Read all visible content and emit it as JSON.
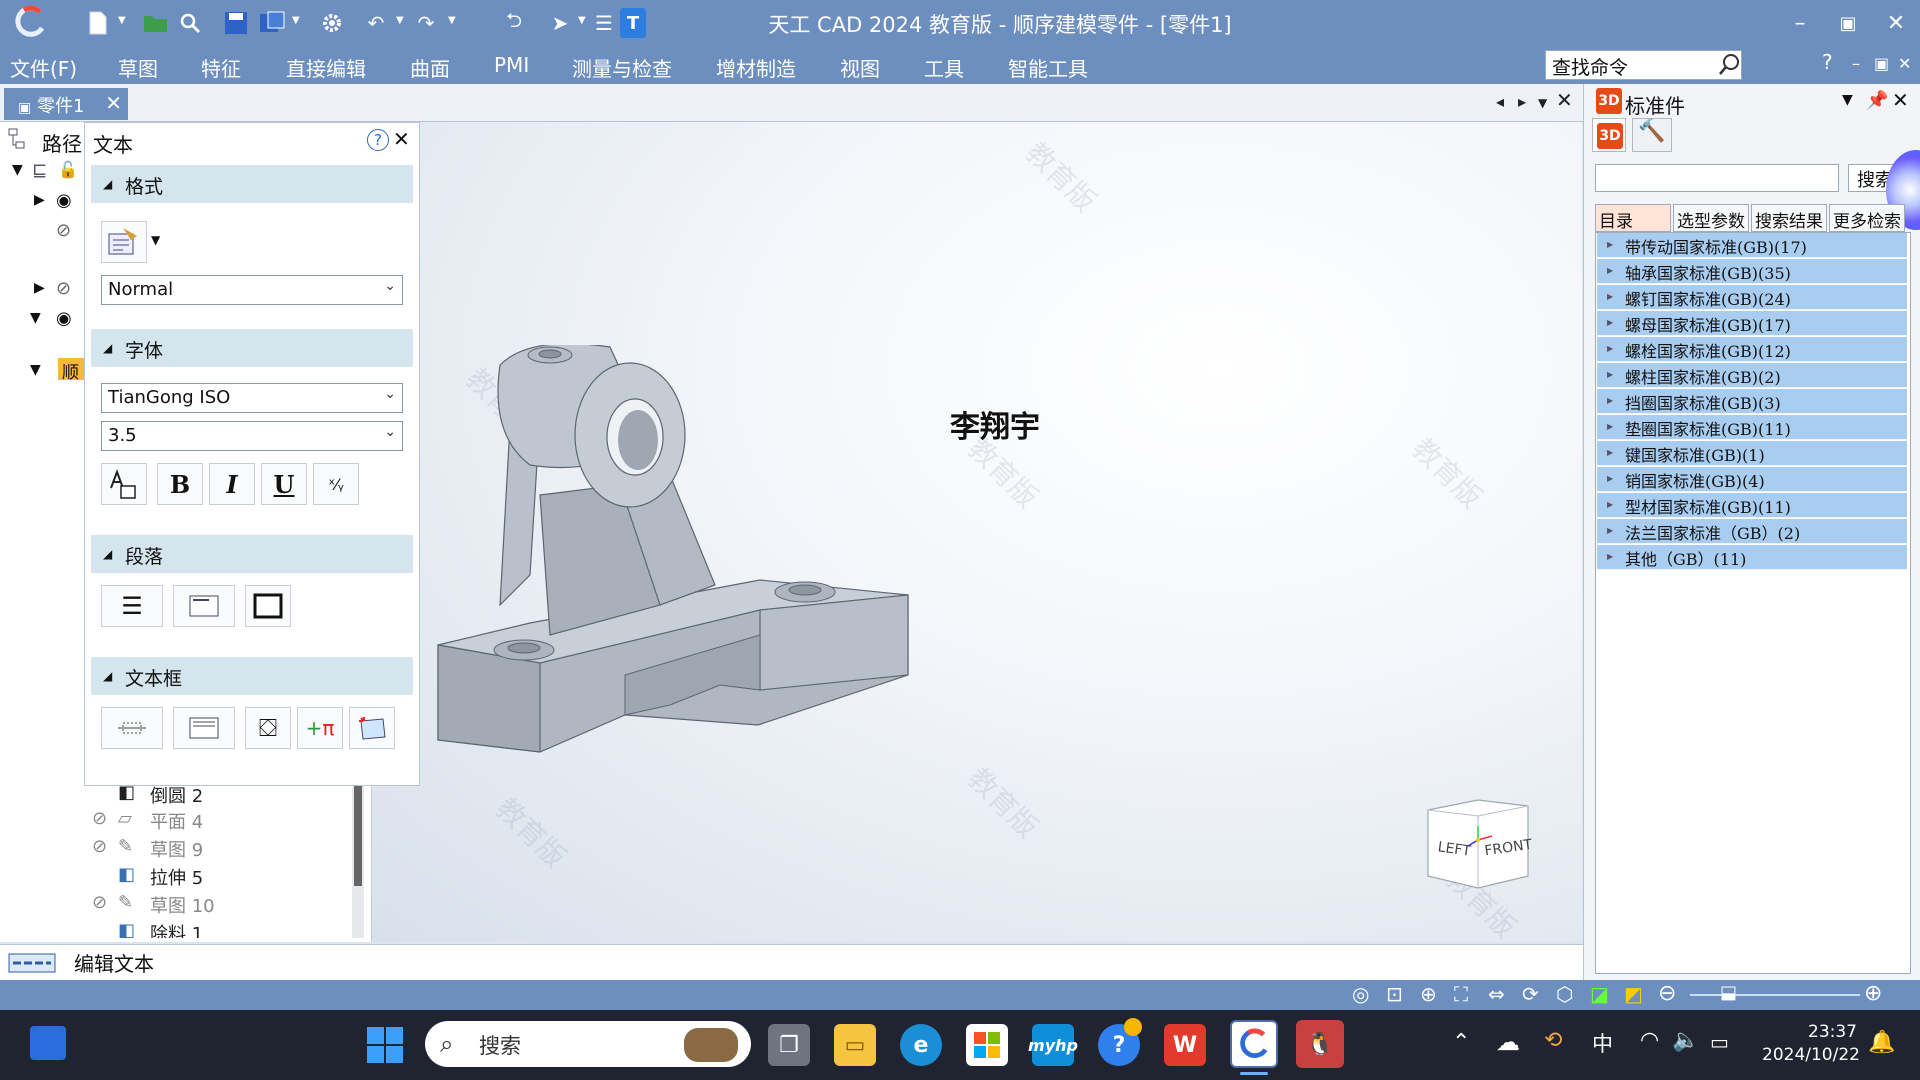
{
  "window": {
    "title": "天工 CAD 2024 教育版 - 顺序建模零件 - [零件1]",
    "minimize": "–",
    "maximize": "▣",
    "close": "✕"
  },
  "menu": {
    "items": [
      "文件(F)",
      "草图",
      "特征",
      "直接编辑",
      "曲面",
      "PMI",
      "测量与检查",
      "增材制造",
      "视图",
      "工具",
      "智能工具"
    ],
    "search_placeholder": "查找命令",
    "help": "?"
  },
  "document": {
    "tab_label": "零件1",
    "tab_close": "✕"
  },
  "tree": {
    "path_label": "路径",
    "items": [
      {
        "name": "倒圆 2"
      },
      {
        "name": "平面 4"
      },
      {
        "name": "草图 9"
      },
      {
        "name": "拉伸 5"
      },
      {
        "name": "草图 10"
      },
      {
        "name": "除料 1"
      }
    ],
    "folder_label": "顺"
  },
  "text_panel": {
    "title": "文本",
    "help": "?",
    "close": "✕",
    "sections": {
      "format": "格式",
      "font": "字体",
      "paragraph": "段落",
      "textbox": "文本框"
    },
    "style_value": "Normal",
    "font_value": "TianGong ISO",
    "size_value": "3.5",
    "bold": "B",
    "italic": "I",
    "underline": "U"
  },
  "viewport": {
    "annotation_text": "李翔宇",
    "watermark": "教育版",
    "viewcube_left": "LEFT",
    "viewcube_front": "FRONT"
  },
  "standard_parts": {
    "title": "标准件",
    "search_button": "搜索",
    "tabs": [
      "目录",
      "选型参数",
      "搜索结果",
      "更多检索"
    ],
    "categories": [
      "带传动国家标准(GB)(17)",
      "轴承国家标准(GB)(35)",
      "螺钉国家标准(GB)(24)",
      "螺母国家标准(GB)(17)",
      "螺栓国家标准(GB)(12)",
      "螺柱国家标准(GB)(2)",
      "挡圈国家标准(GB)(3)",
      "垫圈国家标准(GB)(11)",
      "键国家标准(GB)(1)",
      "销国家标准(GB)(4)",
      "型材国家标准(GB)(11)",
      "法兰国家标准（GB）(2)",
      "其他（GB）(11)"
    ]
  },
  "status": {
    "command_prompt": "编辑文本"
  },
  "taskbar": {
    "search_placeholder": "搜索",
    "ime": "中",
    "time": "23:37",
    "date": "2024/10/22"
  },
  "colors": {
    "title_bar": "#6c8fbf",
    "section_header": "#d4e5ee",
    "category_bg": "#a9cdf0",
    "part_gray": "#b5bcc6"
  }
}
